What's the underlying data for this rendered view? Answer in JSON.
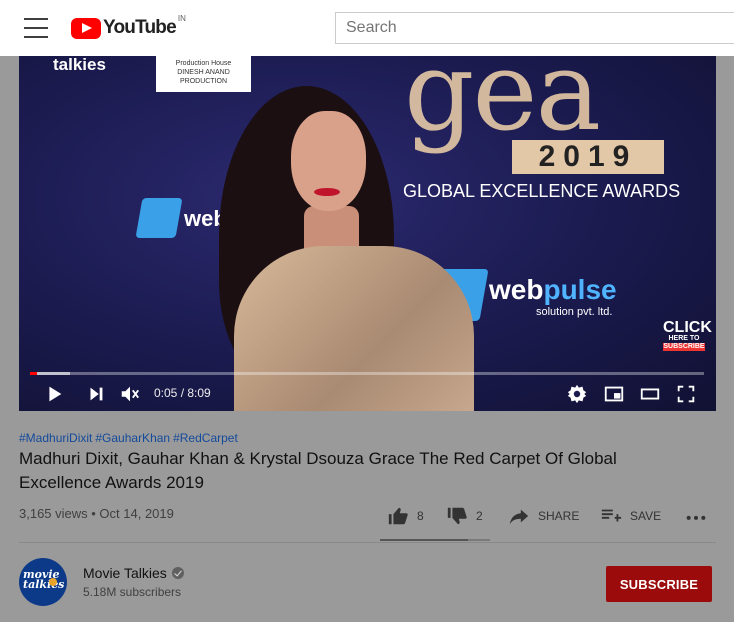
{
  "masthead": {
    "logo_text": "YouTube",
    "country_code": "IN",
    "search_placeholder": "Search"
  },
  "video": {
    "backdrop": {
      "channel_watermark": "talkies",
      "label_lines": [
        "Production House",
        "DINESH ANAND PRODUCTION"
      ],
      "web_small": "web",
      "web_brand": "web",
      "web_brand_accent": "pulse",
      "solution": "solution pvt. ltd.",
      "event_mark": "gea",
      "event_year": "2019",
      "event_name": "GLOBAL EXCELLENCE AWARDS",
      "click_label": "CLICK",
      "click_sub1": "HERE TO",
      "click_sub2": "SUBSCRIBE"
    },
    "progress": 0.0104,
    "loaded": 0.06,
    "time": "0:05 / 8:09",
    "muted": true
  },
  "info": {
    "hashtags": [
      "#MadhuriDixit",
      "#GauharKhan",
      "#RedCarpet"
    ],
    "title": "Madhuri Dixit, Gauhar Khan & Krystal Dsouza Grace The Red Carpet Of Global Excellence Awards 2019",
    "meta": "3,165 views • Oct 14, 2019",
    "likes": "8",
    "dislikes": "2",
    "share_label": "SHARE",
    "save_label": "SAVE",
    "like_ratio": 0.8
  },
  "owner": {
    "avatar_text": "movie talkies",
    "name": "Movie Talkies",
    "verified": true,
    "subscribers": "5.18M subscribers",
    "subscribe_label": "SUBSCRIBE"
  },
  "colors": {
    "brand_red": "#ff0000",
    "subscribe_bg": "#9b0b0b",
    "hashtag_blue": "#144a9c"
  }
}
